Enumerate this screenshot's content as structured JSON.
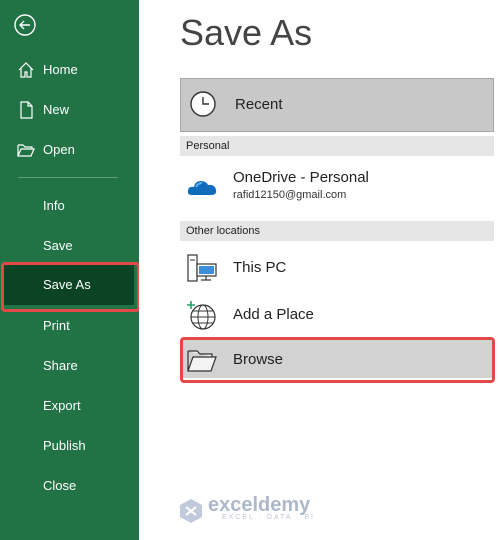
{
  "sidebar": {
    "items": [
      {
        "label": "Home",
        "icon": "home-icon"
      },
      {
        "label": "New",
        "icon": "new-document-icon"
      },
      {
        "label": "Open",
        "icon": "open-folder-icon"
      },
      {
        "label": "Info"
      },
      {
        "label": "Save"
      },
      {
        "label": "Save As",
        "selected": true
      },
      {
        "label": "Print"
      },
      {
        "label": "Share"
      },
      {
        "label": "Export"
      },
      {
        "label": "Publish"
      },
      {
        "label": "Close"
      }
    ]
  },
  "main": {
    "title": "Save As",
    "recent": {
      "label": "Recent",
      "icon": "clock-icon"
    },
    "sections": {
      "personal": "Personal",
      "other": "Other locations"
    },
    "locations": {
      "onedrive": {
        "label": "OneDrive - Personal",
        "account": "rafid12150@gmail.com",
        "icon": "onedrive-cloud-icon"
      },
      "this_pc": {
        "label": "This PC",
        "icon": "computer-icon"
      },
      "add_place": {
        "label": "Add a Place",
        "icon": "globe-add-icon"
      },
      "browse": {
        "label": "Browse",
        "icon": "folder-icon"
      }
    }
  },
  "watermark": {
    "name": "exceldemy",
    "tagline": "EXCEL · DATA · BI"
  },
  "colors": {
    "sidebar": "#217346",
    "selected": "#0b4424",
    "highlight": "#e34949"
  }
}
